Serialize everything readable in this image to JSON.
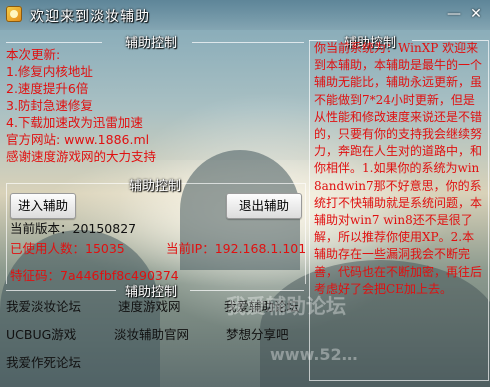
{
  "window": {
    "title": "欢迎来到淡妆辅助",
    "minimize_glyph": "—",
    "close_glyph": "✕"
  },
  "left_panel": {
    "title": "辅助控制",
    "updates": [
      "本次更新:",
      "1.修复内核地址",
      "2.速度提升6倍",
      "3.防封急速修复",
      "4.下载加速改为迅雷加速",
      "官方网站: www.1886.ml",
      "感谢速度游戏网的大力支持"
    ]
  },
  "control_panel": {
    "title": "辅助控制",
    "enter_button": "进入辅助",
    "exit_button": "退出辅助",
    "version": "当前版本：20150827",
    "users": "已使用人数：15035",
    "ip": "当前IP：192.168.1.101",
    "signature": "特征码：7a446fbf8c490374"
  },
  "links_panel": {
    "title": "辅助控制",
    "links": [
      "我爱淡妆论坛",
      "速度游戏网",
      "我爱辅助论坛",
      "UCBUG游戏",
      "淡妆辅助官网",
      "梦想分享吧",
      "我爱作死论坛"
    ]
  },
  "right_panel": {
    "title": "辅助控制",
    "notice": "你当前系统为：WinXP 欢迎来到本辅助，本辅助是最牛的一个辅助无能比，辅助永远更新，虽不能做到7*24小时更新，但是从性能和修改速度来说还是不错的，只要有你的支持我会继续努力，奔跑在人生对的道路中，和你相伴。1.如果你的系统为win8andwin7那不好意思，你的系统打不快辅助就是系统问题，本辅助对win7 win8还不是很了解，所以推荐你使用XP。2.本辅助存在一些漏洞我会不断完善，代码也在不断加密，再往后考虑好了会把CE加上去。"
  },
  "watermark": {
    "text1": "我爱辅助论坛",
    "text2": "www.52…"
  },
  "colors": {
    "accent_red": "#e01010"
  }
}
